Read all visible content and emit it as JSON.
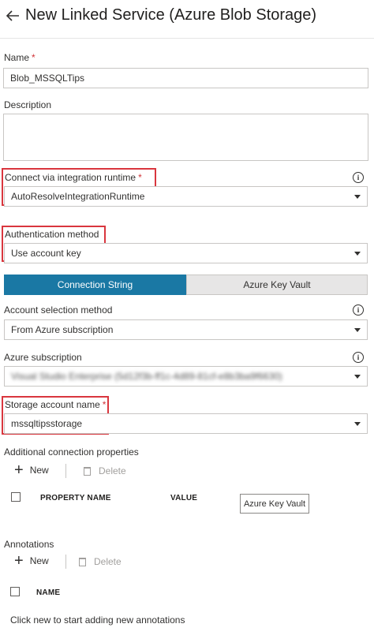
{
  "header": {
    "title": "New Linked Service (Azure Blob Storage)",
    "back_icon": "arrow-left-icon"
  },
  "fields": {
    "name": {
      "label": "Name",
      "required_mark": "*",
      "value": "Blob_MSSQLTips"
    },
    "description": {
      "label": "Description",
      "value": ""
    },
    "integration_runtime": {
      "label": "Connect via integration runtime",
      "required_mark": "*",
      "value": "AutoResolveIntegrationRuntime",
      "info_icon": "i"
    },
    "auth_method": {
      "label": "Authentication method",
      "value": "Use account key"
    },
    "account_selection": {
      "label": "Account selection method",
      "value": "From Azure subscription",
      "info_icon": "i"
    },
    "subscription": {
      "label": "Azure subscription",
      "value": "Visual Studio Enterprise (5d12f3b-ff1c-4d89-81cf-e8b3ba9f6630)",
      "info_icon": "i"
    },
    "storage_account": {
      "label": "Storage account name",
      "required_mark": "*",
      "value": "mssqltipsstorage"
    }
  },
  "auth_tabs": [
    {
      "label": "Connection String",
      "active": true
    },
    {
      "label": "Azure Key Vault",
      "active": false
    }
  ],
  "connection_properties": {
    "heading": "Additional connection properties",
    "new_label": "New",
    "delete_label": "Delete",
    "col_property": "PROPERTY NAME",
    "col_value": "VALUE",
    "key_vault_button": "Azure Key Vault"
  },
  "annotations": {
    "heading": "Annotations",
    "new_label": "New",
    "delete_label": "Delete",
    "col_name": "NAME",
    "hint": "Click new to start adding new annotations"
  },
  "colors": {
    "accent": "#1a78a4",
    "highlight": "#d9363e",
    "required": "#d13438"
  }
}
